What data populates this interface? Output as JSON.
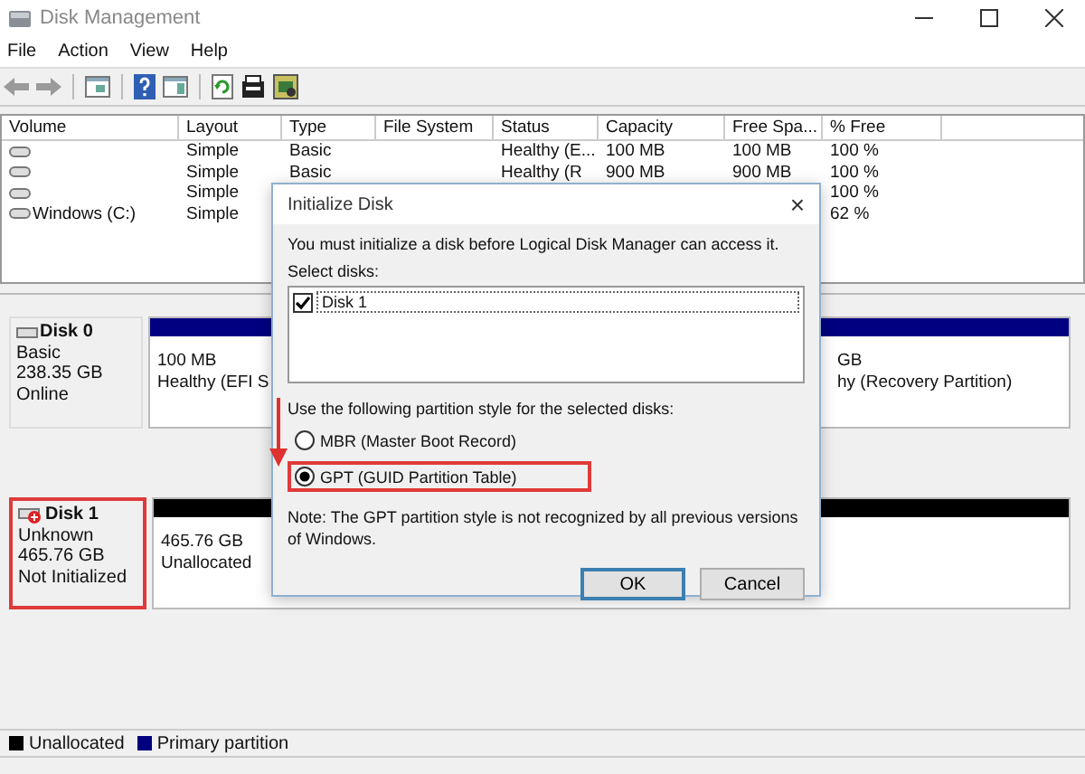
{
  "window": {
    "title": "Disk Management"
  },
  "menu": [
    "File",
    "Action",
    "View",
    "Help"
  ],
  "volumes": {
    "columns": [
      "Volume",
      "Layout",
      "Type",
      "File System",
      "Status",
      "Capacity",
      "Free Spa...",
      "% Free"
    ],
    "rows": [
      [
        null,
        "Simple",
        "Basic",
        null,
        "Healthy (E...",
        "100 MB",
        "100 MB",
        "100 %"
      ],
      [
        null,
        "Simple",
        "Basic",
        null,
        "Healthy (R",
        "900 MB",
        "900 MB",
        "100 %"
      ],
      [
        null,
        "Simple",
        null,
        null,
        null,
        null,
        null,
        "100 %"
      ],
      [
        "Windows (C:)",
        "Simple",
        null,
        null,
        null,
        null,
        null,
        "62 %"
      ]
    ]
  },
  "disks": [
    {
      "name": "Disk 0",
      "type": "Basic",
      "size": "238.35 GB",
      "status": "Online",
      "kind": "online",
      "highlighted": false,
      "partitions": [
        {
          "size": "100 MB",
          "status": "Healthy (EFI S",
          "kind": "primary"
        },
        {
          "size": "GB",
          "status": "hy (Recovery Partition)",
          "kind": "primary"
        }
      ]
    },
    {
      "name": "Disk 1",
      "type": "Unknown",
      "size": "465.76 GB",
      "status": "Not Initialized",
      "kind": "uninitialized",
      "highlighted": true,
      "partitions": [
        {
          "size": "465.76 GB",
          "status": "Unallocated",
          "kind": "unallocated"
        }
      ]
    }
  ],
  "legend": [
    {
      "label": "Unallocated",
      "color": "#000000"
    },
    {
      "label": "Primary partition",
      "color": "#000080"
    }
  ],
  "dialog": {
    "title": "Initialize Disk",
    "close": "×",
    "message": "You must initialize a disk before Logical Disk Manager can access it.",
    "select_label": "Select disks:",
    "disks": [
      {
        "label": "Disk 1",
        "checked": true
      }
    ],
    "style_label": "Use the following partition style for the selected disks:",
    "styles": [
      {
        "label": "MBR (Master Boot Record)",
        "selected": false,
        "highlighted": false
      },
      {
        "label": "GPT (GUID Partition Table)",
        "selected": true,
        "highlighted": true
      }
    ],
    "note": "Note: The GPT partition style is not recognized by all previous versions of Windows.",
    "buttons": [
      {
        "label": "OK",
        "default": true
      },
      {
        "label": "Cancel",
        "default": false
      }
    ]
  }
}
